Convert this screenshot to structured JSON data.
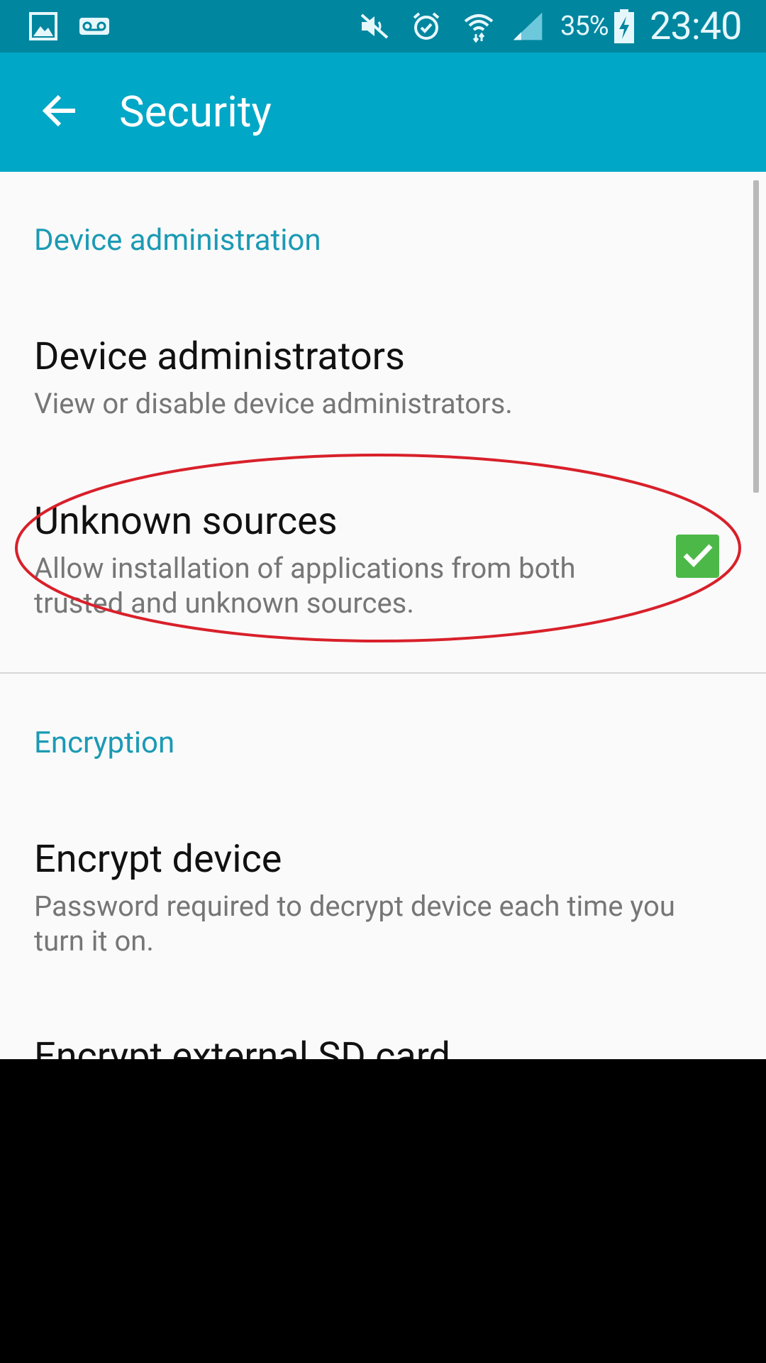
{
  "status_bar": {
    "icons_left": [
      "gallery-icon",
      "voicemail-icon"
    ],
    "icons_right": [
      "mute-icon",
      "alarm-icon",
      "wifi-icon",
      "signal-icon"
    ],
    "battery_percent": "35%",
    "battery_state": "charging",
    "time": "23:40"
  },
  "action_bar": {
    "back_icon": "back-arrow-icon",
    "title": "Security"
  },
  "sections": [
    {
      "header": "Device administration",
      "items": [
        {
          "title": "Device administrators",
          "summary": "View or disable device administrators."
        },
        {
          "title": "Unknown sources",
          "summary_line1": "Allow installation of applications from both",
          "summary_line2": "trusted and unknown sources.",
          "checked": true
        }
      ]
    },
    {
      "header": "Encryption",
      "items": [
        {
          "title": "Encrypt device",
          "summary_line1": "Password required to decrypt device each time you",
          "summary_line2": "turn it on."
        },
        {
          "title": "Encrypt external SD card"
        }
      ]
    }
  ],
  "colors": {
    "status_bar": "#00869f",
    "action_bar": "#00a7c6",
    "section_header": "#1b9ab4",
    "checkbox": "#4cb848",
    "annotation": "#d8202a"
  }
}
